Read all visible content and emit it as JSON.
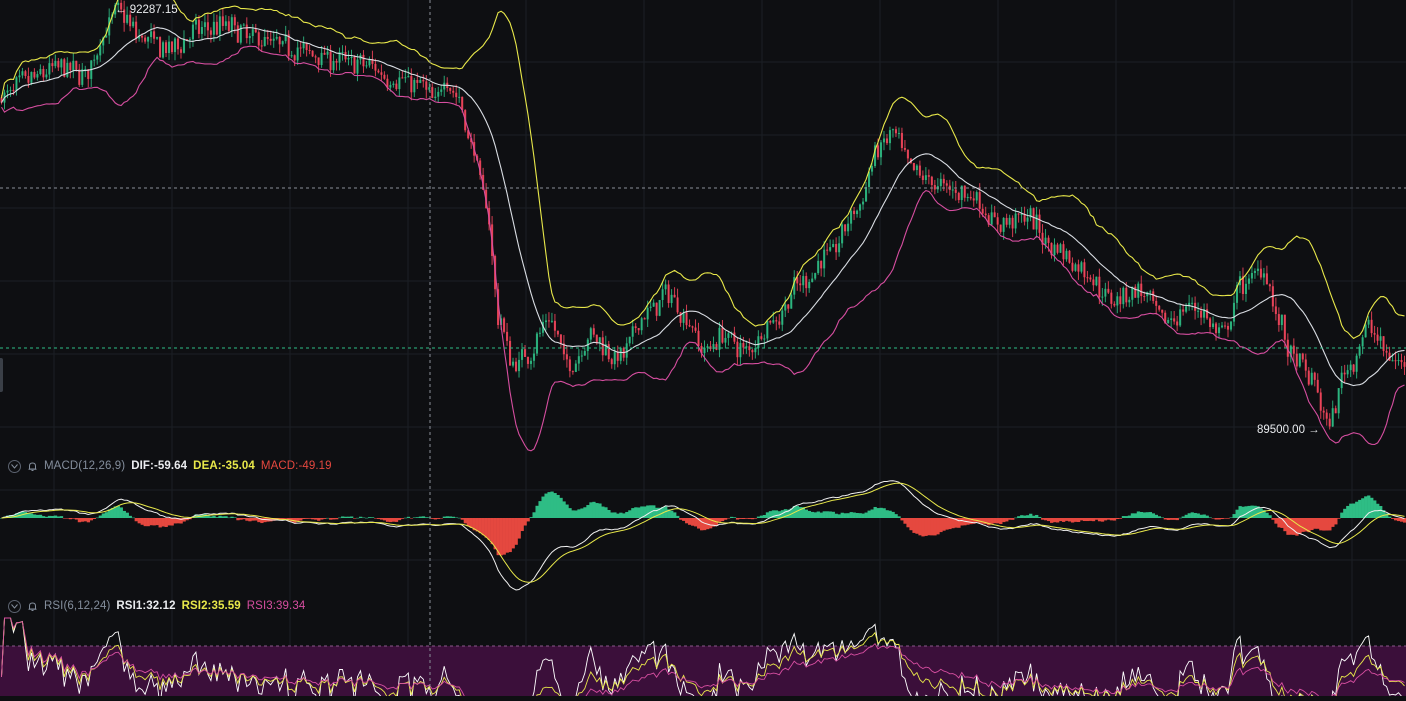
{
  "annotations": {
    "high_label": "← 92287.15",
    "low_label": "89500.00 →"
  },
  "macd_legend": {
    "name": "MACD(12,26,9)",
    "dif": "DIF:-59.64",
    "dea": "DEA:-35.04",
    "macd": "MACD:-49.19"
  },
  "rsi_legend": {
    "name": "RSI(6,12,24)",
    "rsi1": "RSI1:32.12",
    "rsi2": "RSI2:35.59",
    "rsi3": "RSI3:39.34"
  },
  "colors": {
    "background": "#0e0f12",
    "grid": "#1c1f25",
    "up": "#2ebd85",
    "down": "#f6465d",
    "boll_upper": "#e8e84a",
    "boll_mid": "#d9dde3",
    "boll_lower": "#d64ea0",
    "dif": "#f0f0f0",
    "dea": "#e8e84a",
    "macd_pos": "#2ebd85",
    "macd_neg": "#e5483f",
    "rsi1": "#ffffff",
    "rsi2": "#e8e84a",
    "rsi3": "#d64ea0",
    "rsi_band": "#3b0f3a"
  },
  "chart_data": {
    "type": "line",
    "price_high": 92287.15,
    "price_low": 89500.0,
    "price_path": [
      [
        0,
        91700
      ],
      [
        0.02,
        91820
      ],
      [
        0.04,
        91900
      ],
      [
        0.06,
        91860
      ],
      [
        0.075,
        92150
      ],
      [
        0.082,
        92287.15
      ],
      [
        0.1,
        92100
      ],
      [
        0.12,
        92020
      ],
      [
        0.14,
        92150
      ],
      [
        0.16,
        92180
      ],
      [
        0.18,
        92100
      ],
      [
        0.2,
        92050
      ],
      [
        0.22,
        92000
      ],
      [
        0.24,
        91950
      ],
      [
        0.26,
        91920
      ],
      [
        0.28,
        91820
      ],
      [
        0.3,
        91780
      ],
      [
        0.31,
        91650
      ],
      [
        0.315,
        91850
      ],
      [
        0.325,
        91700
      ],
      [
        0.335,
        91380
      ],
      [
        0.345,
        91000
      ],
      [
        0.355,
        90200
      ],
      [
        0.365,
        89900
      ],
      [
        0.375,
        89980
      ],
      [
        0.39,
        90200
      ],
      [
        0.405,
        89900
      ],
      [
        0.42,
        90100
      ],
      [
        0.44,
        89950
      ],
      [
        0.46,
        90250
      ],
      [
        0.475,
        90380
      ],
      [
        0.49,
        90200
      ],
      [
        0.5,
        90000
      ],
      [
        0.515,
        90100
      ],
      [
        0.53,
        90000
      ],
      [
        0.55,
        90200
      ],
      [
        0.57,
        90450
      ],
      [
        0.59,
        90650
      ],
      [
        0.61,
        90950
      ],
      [
        0.625,
        91350
      ],
      [
        0.635,
        91450
      ],
      [
        0.65,
        91200
      ],
      [
        0.67,
        91100
      ],
      [
        0.69,
        91050
      ],
      [
        0.71,
        90850
      ],
      [
        0.73,
        90900
      ],
      [
        0.75,
        90700
      ],
      [
        0.77,
        90550
      ],
      [
        0.79,
        90350
      ],
      [
        0.81,
        90400
      ],
      [
        0.83,
        90200
      ],
      [
        0.85,
        90300
      ],
      [
        0.87,
        90100
      ],
      [
        0.885,
        90450
      ],
      [
        0.9,
        90550
      ],
      [
        0.91,
        90200
      ],
      [
        0.92,
        89950
      ],
      [
        0.935,
        89800
      ],
      [
        0.945,
        89500
      ],
      [
        0.96,
        89900
      ],
      [
        0.975,
        90150
      ],
      [
        0.99,
        89950
      ],
      [
        1.0,
        89900
      ]
    ],
    "price_reference_lines": [
      91550,
      90270
    ],
    "macd_range": [
      -150,
      100
    ],
    "rsi_range": [
      0,
      100
    ],
    "rsi_band": [
      30,
      70
    ]
  }
}
